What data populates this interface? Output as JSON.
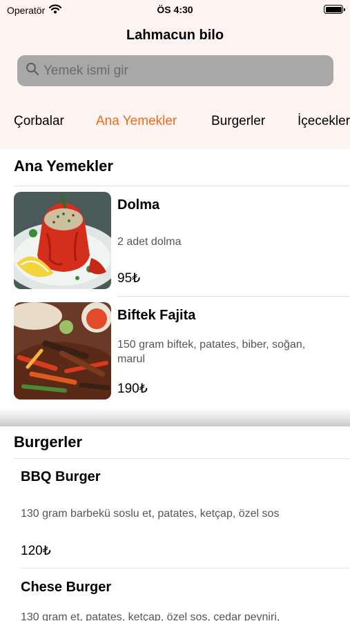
{
  "status_bar": {
    "carrier": "Operatör",
    "time": "ÖS 4:30"
  },
  "nav": {
    "title": "Lahmacun bilo"
  },
  "search": {
    "placeholder": "Yemek ismi gir"
  },
  "tabs": [
    {
      "label": "Çorbalar",
      "active": false
    },
    {
      "label": "Ana Yemekler",
      "active": true
    },
    {
      "label": "Burgerler",
      "active": false
    },
    {
      "label": "İçecekler",
      "active": false
    }
  ],
  "colors": {
    "accent": "#f06a1a",
    "header_bg": "#fdf3f0",
    "search_bg": "#a8a8a8"
  },
  "sections": [
    {
      "title": "Ana Yemekler",
      "items": [
        {
          "name": "Dolma",
          "description": "2 adet dolma",
          "price": "95₺",
          "image": "stuffed-pepper-image"
        },
        {
          "name": "Biftek Fajita",
          "description": "150 gram biftek, patates, biber, soğan, marul",
          "price": "190₺",
          "image": "beef-fajita-image"
        }
      ]
    },
    {
      "title": "Burgerler",
      "items": [
        {
          "name": "BBQ Burger",
          "description": "130 gram barbekü soslu et, patates, ketçap, özel sos",
          "price": "120₺"
        },
        {
          "name": "Chese Burger",
          "description": "130 gram et, patates, ketçap, özel sos, çedar peyniri,"
        }
      ]
    }
  ]
}
